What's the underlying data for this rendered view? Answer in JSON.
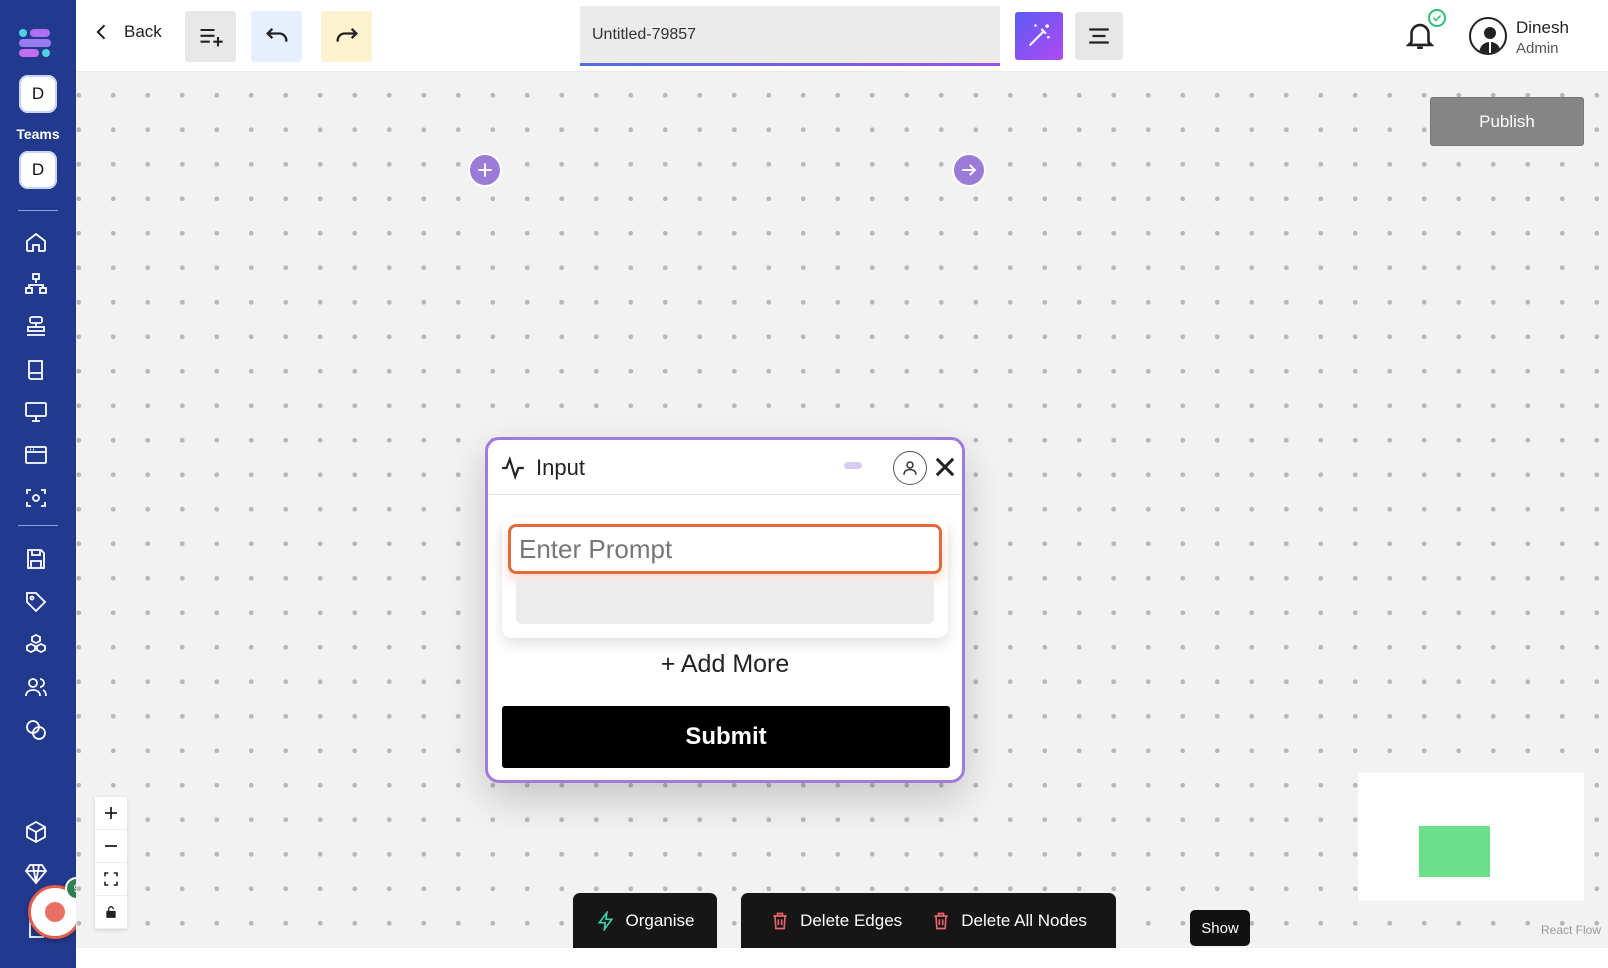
{
  "sidebar": {
    "team_badges": [
      "D",
      "D"
    ],
    "teams_label": "Teams",
    "nav_icons": [
      "home-icon",
      "sitemap-icon",
      "database-icon",
      "book-icon",
      "monitor-icon",
      "browser-icon",
      "scan-icon",
      "save-icon",
      "tag-icon",
      "cubes-icon",
      "users-icon",
      "coins-icon",
      "box-icon",
      "gem-icon",
      "document-icon"
    ],
    "recorder_badge": "9"
  },
  "topbar": {
    "back_label": "Back",
    "title_value": "Untitled-79857",
    "user_name": "Dinesh",
    "user_role": "Admin"
  },
  "canvas": {
    "publish_label": "Publish",
    "node": {
      "title": "Input",
      "prompt_placeholder": "Enter Prompt",
      "add_more_label": "+ Add More",
      "submit_label": "Submit"
    },
    "toolbar": {
      "organise_label": "Organise",
      "delete_edges_label": "Delete Edges",
      "delete_all_nodes_label": "Delete All Nodes"
    },
    "show_label": "Show",
    "attribution": "React Flow"
  },
  "colors": {
    "sidebar_bg": "#213a8e",
    "node_border": "#a07bd9",
    "prompt_border": "#e36a3a",
    "minimap_node": "#6ddf8a"
  }
}
